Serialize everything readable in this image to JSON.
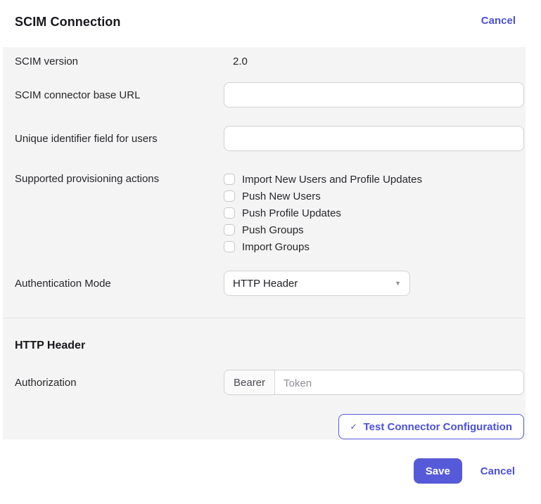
{
  "colors": {
    "accent": "#575AD8",
    "link": "#4B50DC",
    "panel_background": "#F4F4F4",
    "input_border": "#D2D2D7",
    "text": "#1F1F24",
    "placeholder": "#8F8F97"
  },
  "header": {
    "title": "SCIM Connection",
    "cancel_label": "Cancel"
  },
  "form": {
    "scim_version": {
      "label": "SCIM version",
      "value": "2.0"
    },
    "connector_base_url": {
      "label": "SCIM connector base URL",
      "value": ""
    },
    "unique_identifier": {
      "label": "Unique identifier field for users",
      "value": ""
    },
    "provisioning_actions": {
      "label": "Supported provisioning actions",
      "options": [
        {
          "label": "Import New Users and Profile Updates",
          "checked": false
        },
        {
          "label": "Push New Users",
          "checked": false
        },
        {
          "label": "Push Profile Updates",
          "checked": false
        },
        {
          "label": "Push Groups",
          "checked": false
        },
        {
          "label": "Import Groups",
          "checked": false
        }
      ]
    },
    "authentication_mode": {
      "label": "Authentication Mode",
      "selected": "HTTP Header"
    }
  },
  "http_header": {
    "section_title": "HTTP Header",
    "authorization": {
      "label": "Authorization",
      "prefix": "Bearer",
      "placeholder": "Token",
      "value": ""
    },
    "test_button": {
      "icon": "check-icon",
      "label": "Test Connector Configuration"
    }
  },
  "footer": {
    "save_label": "Save",
    "cancel_label": "Cancel"
  }
}
